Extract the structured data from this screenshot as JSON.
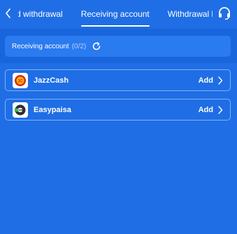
{
  "header": {
    "tabs": [
      {
        "label": "d withdrawal",
        "active": false
      },
      {
        "label": "Receiving account",
        "active": true
      },
      {
        "label": "Withdrawal l",
        "active": false
      }
    ],
    "back_icon": "chevron-left-icon",
    "support_icon": "headset-icon"
  },
  "receiving": {
    "title": "Receiving account",
    "count": "(0/2)",
    "refresh_icon": "refresh-icon"
  },
  "accounts": [
    {
      "name": "JazzCash",
      "action": "Add",
      "logo_icon": "jazzcash-logo-icon"
    },
    {
      "name": "Easypaisa",
      "action": "Add",
      "logo_icon": "easypaisa-logo-icon"
    }
  ],
  "colors": {
    "background": "#1f6ee5",
    "card": "#2a7af0",
    "row_border": "#7fb0f7"
  }
}
